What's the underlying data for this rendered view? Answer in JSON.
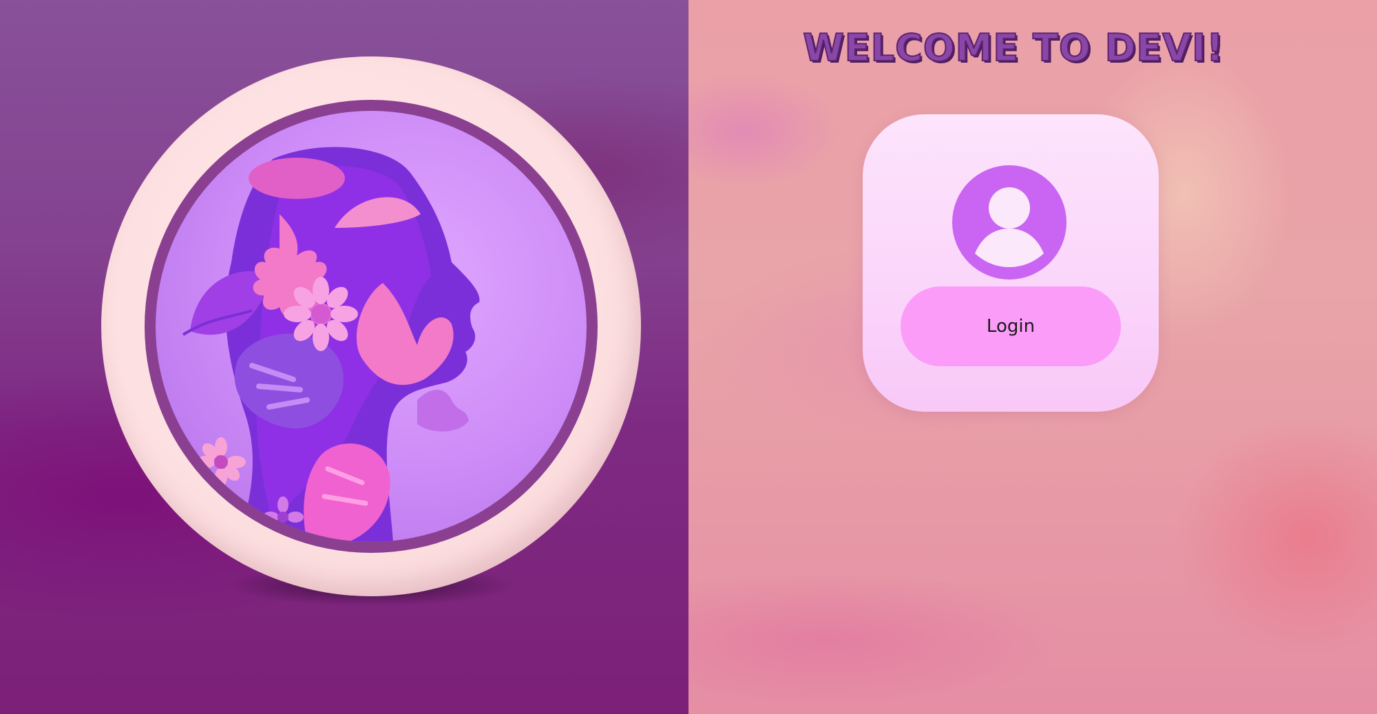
{
  "welcome": {
    "title": "WELCOME  TO DEVI!"
  },
  "hero": {
    "illustration": "woman-profile-floral-papercut"
  },
  "login_card": {
    "avatar_icon": "user-avatar-icon",
    "button_label": "Login"
  },
  "colors": {
    "left_bg": "#84418f",
    "right_bg": "#e8a4a8",
    "medallion_outer": "#fde0e1",
    "medallion_ring": "#8a3f90",
    "medallion_inner": "#cd8cf7",
    "title_fill": "#8a47a8",
    "title_outline": "#5c2370",
    "card_bg": "#fbd6fb",
    "avatar": "#c965f2",
    "button_bg": "#fb9cf9"
  }
}
